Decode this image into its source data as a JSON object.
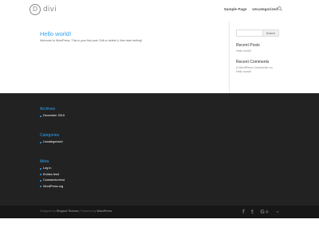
{
  "header": {
    "logo_mark": "D",
    "logo_text": "divi",
    "nav": [
      "Sample Page",
      "Uncategorized"
    ]
  },
  "main": {
    "post_title": "Hello world!",
    "post_excerpt": "Welcome to WordPress. This is your first post. Edit or delete it, then start writing!"
  },
  "sidebar": {
    "search_button": "Search",
    "recent_posts_title": "Recent Posts",
    "recent_posts": [
      "Hello world!"
    ],
    "recent_comments_title": "Recent Comments",
    "recent_comments": [
      "A WordPress Commenter on Hello world!"
    ]
  },
  "footer": {
    "archives_title": "Archives",
    "archives": [
      "December 2019"
    ],
    "categories_title": "Categories",
    "categories": [
      "Uncategorized"
    ],
    "meta_title": "Meta",
    "meta": [
      "Log in",
      "Entries feed",
      "Comments feed",
      "WordPress.org"
    ]
  },
  "bottom": {
    "credits_prefix": "Designed by",
    "credits_theme": "Elegant Themes",
    "credits_sep": "| Powered by",
    "credits_wp": "WordPress",
    "social_icons": [
      "facebook-icon",
      "twitter-icon",
      "google-plus-icon",
      "rss-icon"
    ],
    "social_glyphs": [
      "f",
      "t",
      "G+",
      "⌁"
    ]
  },
  "colors": {
    "accent": "#2ea3f2",
    "footer_bg": "#222222",
    "bottom_bg": "#171717"
  }
}
